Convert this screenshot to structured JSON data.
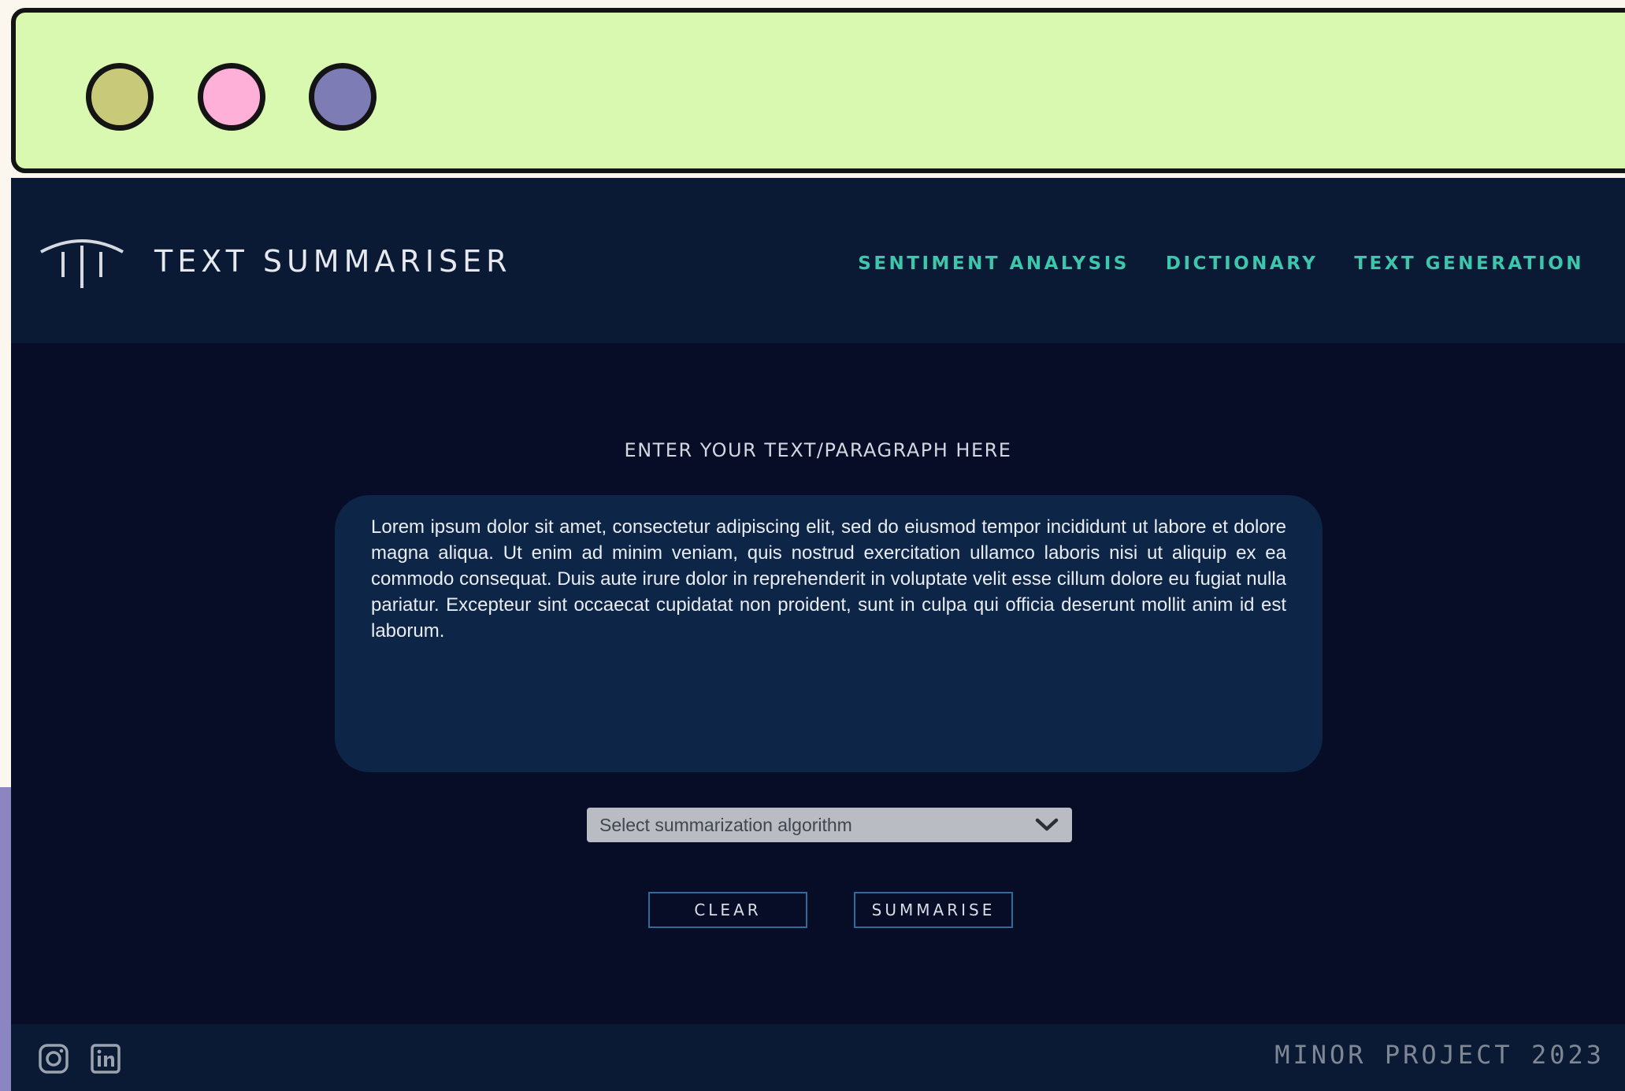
{
  "window": {
    "controls": [
      {
        "name": "traffic-light-1",
        "color": "#c9c97a"
      },
      {
        "name": "traffic-light-2",
        "color": "#ffb0d9"
      },
      {
        "name": "traffic-light-3",
        "color": "#7d7cb5"
      }
    ]
  },
  "header": {
    "logo_icon": "pillars-logo-icon",
    "title": "TEXT SUMMARISER",
    "nav": [
      {
        "label": "SENTIMENT ANALYSIS"
      },
      {
        "label": "DICTIONARY"
      },
      {
        "label": "TEXT GENERATION"
      }
    ],
    "nav_color": "#3ec6ad"
  },
  "main": {
    "prompt": "ENTER YOUR TEXT/PARAGRAPH HERE",
    "input_text": "Lorem ipsum dolor sit amet, consectetur adipiscing elit, sed do eiusmod tempor incididunt ut labore et dolore magna aliqua. Ut enim ad minim veniam, quis nostrud exercitation ullamco laboris nisi ut aliquip ex ea commodo consequat. Duis aute irure dolor in reprehenderit in voluptate velit esse cillum dolore eu fugiat nulla pariatur. Excepteur sint occaecat cupidatat non proident, sunt in culpa qui officia deserunt mollit anim id est laborum.",
    "algorithm_select": {
      "placeholder": "Select summarization algorithm",
      "icon": "chevron-down-icon"
    },
    "buttons": {
      "clear": "CLEAR",
      "summarise": "SUMMARISE"
    }
  },
  "footer": {
    "social": [
      {
        "icon": "instagram-icon"
      },
      {
        "icon": "linkedin-icon"
      }
    ],
    "credit": "MINOR PROJECT 2023"
  }
}
